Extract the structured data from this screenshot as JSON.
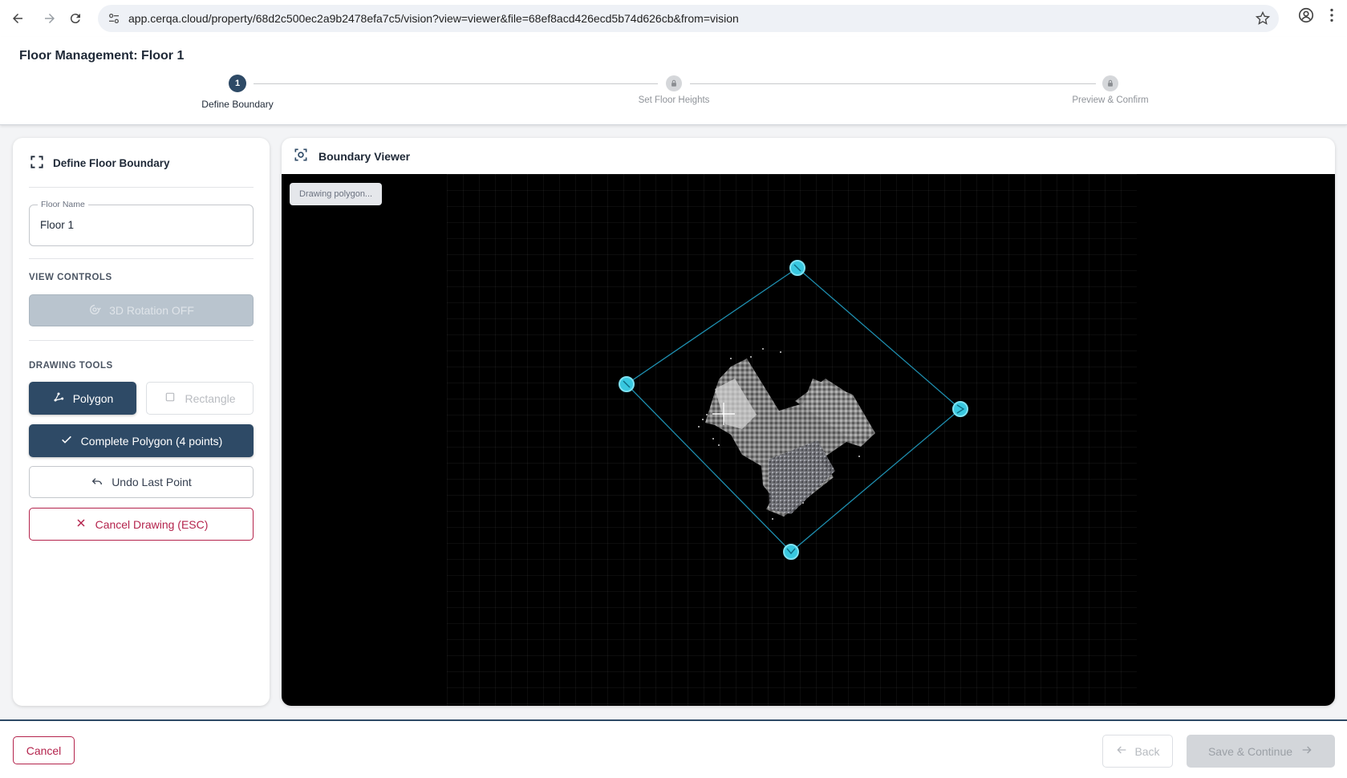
{
  "browser": {
    "url": "app.cerqa.cloud/property/68d2c500ec2a9b2478efa7c5/vision?view=viewer&file=68ef8acd426ecd5b74d626cb&from=vision"
  },
  "header": {
    "title": "Floor Management: Floor 1",
    "steps": [
      {
        "number": "1",
        "label": "Define Boundary",
        "state": "active"
      },
      {
        "number": "",
        "label": "Set Floor Heights",
        "state": "locked"
      },
      {
        "number": "",
        "label": "Preview & Confirm",
        "state": "locked"
      }
    ]
  },
  "left_panel": {
    "title": "Define Floor Boundary",
    "floor_name": {
      "label": "Floor Name",
      "value": "Floor 1"
    },
    "view_controls": {
      "section": "VIEW CONTROLS",
      "rotation_label": "3D Rotation OFF"
    },
    "drawing_tools": {
      "section": "DRAWING TOOLS",
      "polygon_label": "Polygon",
      "rectangle_label": "Rectangle",
      "complete_label": "Complete Polygon (4 points)",
      "undo_label": "Undo Last Point",
      "cancel_label": "Cancel Drawing (ESC)"
    }
  },
  "viewer": {
    "title": "Boundary Viewer",
    "status": "Drawing polygon...",
    "accent_color": "#38c8e0"
  },
  "footer": {
    "cancel_label": "Cancel",
    "back_label": "Back",
    "save_label": "Save & Continue"
  }
}
